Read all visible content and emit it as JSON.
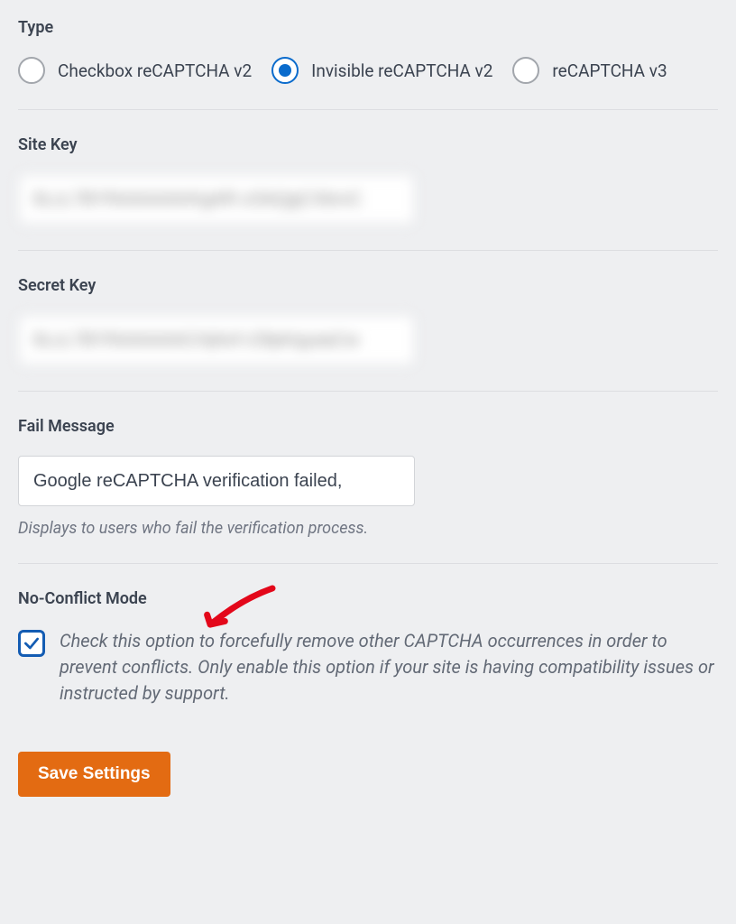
{
  "type": {
    "label": "Type",
    "options": [
      {
        "label": "Checkbox reCAPTCHA v2",
        "selected": false
      },
      {
        "label": "Invisible reCAPTCHA v2",
        "selected": true
      },
      {
        "label": "reCAPTCHA v3",
        "selected": false
      }
    ]
  },
  "site_key": {
    "label": "Site Key",
    "value": "6LcL7BYfAAAAAArKgAR-zGkQgCXbrvC"
  },
  "secret_key": {
    "label": "Secret Key",
    "value": "6LcL7BYfAAAAAACHjAvf-r29pKqyaaCw"
  },
  "fail_message": {
    "label": "Fail Message",
    "value": "Google reCAPTCHA verification failed,",
    "helper": "Displays to users who fail the verification process."
  },
  "no_conflict": {
    "label": "No-Conflict Mode",
    "checked": true,
    "description": "Check this option to forcefully remove other CAPTCHA occurrences in order to prevent conflicts. Only enable this option if your site is having compatibility issues or instructed by support."
  },
  "save_button": "Save Settings"
}
